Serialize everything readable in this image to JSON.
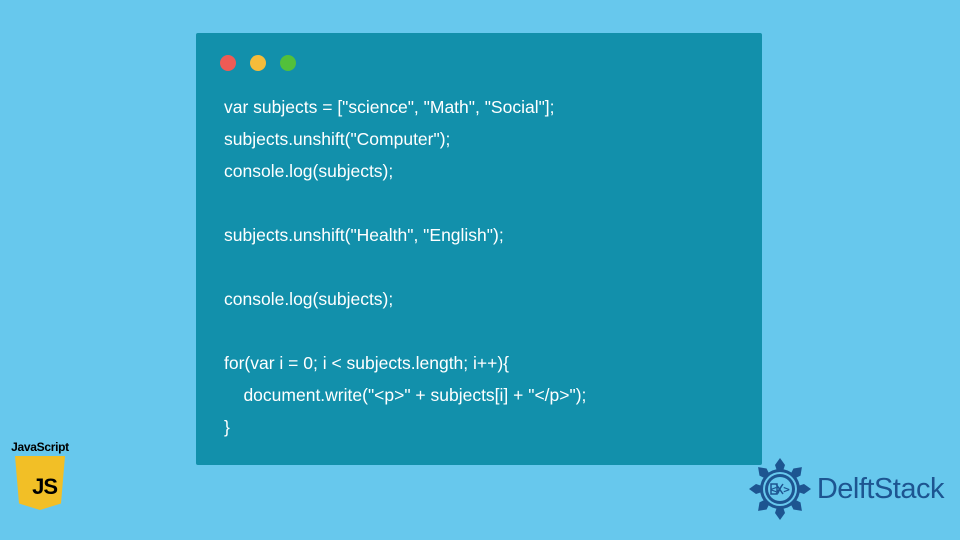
{
  "code": {
    "lines": [
      "var subjects = [\"science\", \"Math\", \"Social\"];",
      "subjects.unshift(\"Computer\");",
      "console.log(subjects);",
      "",
      "subjects.unshift(\"Health\", \"English\");",
      "",
      "console.log(subjects);",
      "",
      "for(var i = 0; i < subjects.length; i++){",
      "    document.write(\"<p>\" + subjects[i] + \"</p>\");",
      "}"
    ]
  },
  "badges": {
    "js_label": "JavaScript",
    "js_icon_text": "JS",
    "brand_name": "DelftStack"
  },
  "colors": {
    "bg": "#67c8ed",
    "window": "#1290ab",
    "red": "#ee5b55",
    "yellow": "#f5bc3a",
    "green": "#52c03b",
    "brand_blue": "#1d5591",
    "js_yellow": "#f2bf26"
  }
}
